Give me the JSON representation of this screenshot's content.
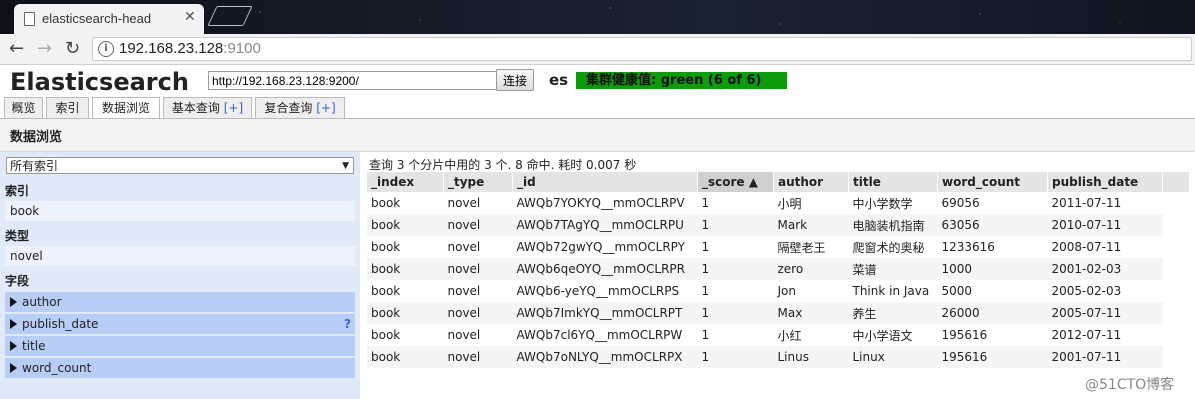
{
  "browser": {
    "tab_title": "elasticsearch-head",
    "url_host": "192.168.23.128",
    "url_port": ":9100"
  },
  "app": {
    "title": "Elasticsearch",
    "connect_url": "http://192.168.23.128:9200/",
    "connect_label": "连接",
    "cluster_name": "es",
    "health_text": "集群健康值: green (6 of 6)",
    "health_color": "#0c9c0c"
  },
  "tabs": [
    {
      "label": "概览"
    },
    {
      "label": "索引"
    },
    {
      "label": "数据浏览"
    },
    {
      "label": "基本查询",
      "plus": "[+]"
    },
    {
      "label": "复合查询",
      "plus": "[+]"
    }
  ],
  "section_title": "数据浏览",
  "sidebar": {
    "index_select": "所有索引",
    "index_header": "索引",
    "index_value": "book",
    "type_header": "类型",
    "type_value": "novel",
    "fields_header": "字段",
    "fields": [
      "author",
      "publish_date",
      "title",
      "word_count"
    ],
    "help_mark": "?"
  },
  "results": {
    "summary": "查询 3 个分片中用的 3 个. 8 命中. 耗时 0.007 秒",
    "columns": [
      "_index",
      "_type",
      "_id",
      "_score ▲",
      "author",
      "title",
      "word_count",
      "publish_date"
    ],
    "rows": [
      [
        "book",
        "novel",
        "AWQb7YOKYQ__mmOCLRPV",
        "1",
        "小明",
        "中小学数学",
        "69056",
        "2011-07-11"
      ],
      [
        "book",
        "novel",
        "AWQb7TAgYQ__mmOCLRPU",
        "1",
        "Mark",
        "电脑装机指南",
        "63056",
        "2010-07-11"
      ],
      [
        "book",
        "novel",
        "AWQb72gwYQ__mmOCLRPY",
        "1",
        "隔壁老王",
        "爬窗术的奥秘",
        "1233616",
        "2008-07-11"
      ],
      [
        "book",
        "novel",
        "AWQb6qeOYQ__mmOCLRPR",
        "1",
        "zero",
        "菜谱",
        "1000",
        "2001-02-03"
      ],
      [
        "book",
        "novel",
        "AWQb6-yeYQ__mmOCLRPS",
        "1",
        "Jon",
        "Think in Java",
        "5000",
        "2005-02-03"
      ],
      [
        "book",
        "novel",
        "AWQb7ImkYQ__mmOCLRPT",
        "1",
        "Max",
        "养生",
        "26000",
        "2005-07-11"
      ],
      [
        "book",
        "novel",
        "AWQb7cl6YQ__mmOCLRPW",
        "1",
        "小红",
        "中小学语文",
        "195616",
        "2012-07-11"
      ],
      [
        "book",
        "novel",
        "AWQb7oNLYQ__mmOCLRPX",
        "1",
        "Linus",
        "Linux",
        "195616",
        "2001-07-11"
      ]
    ]
  },
  "watermark": "@51CTO博客"
}
